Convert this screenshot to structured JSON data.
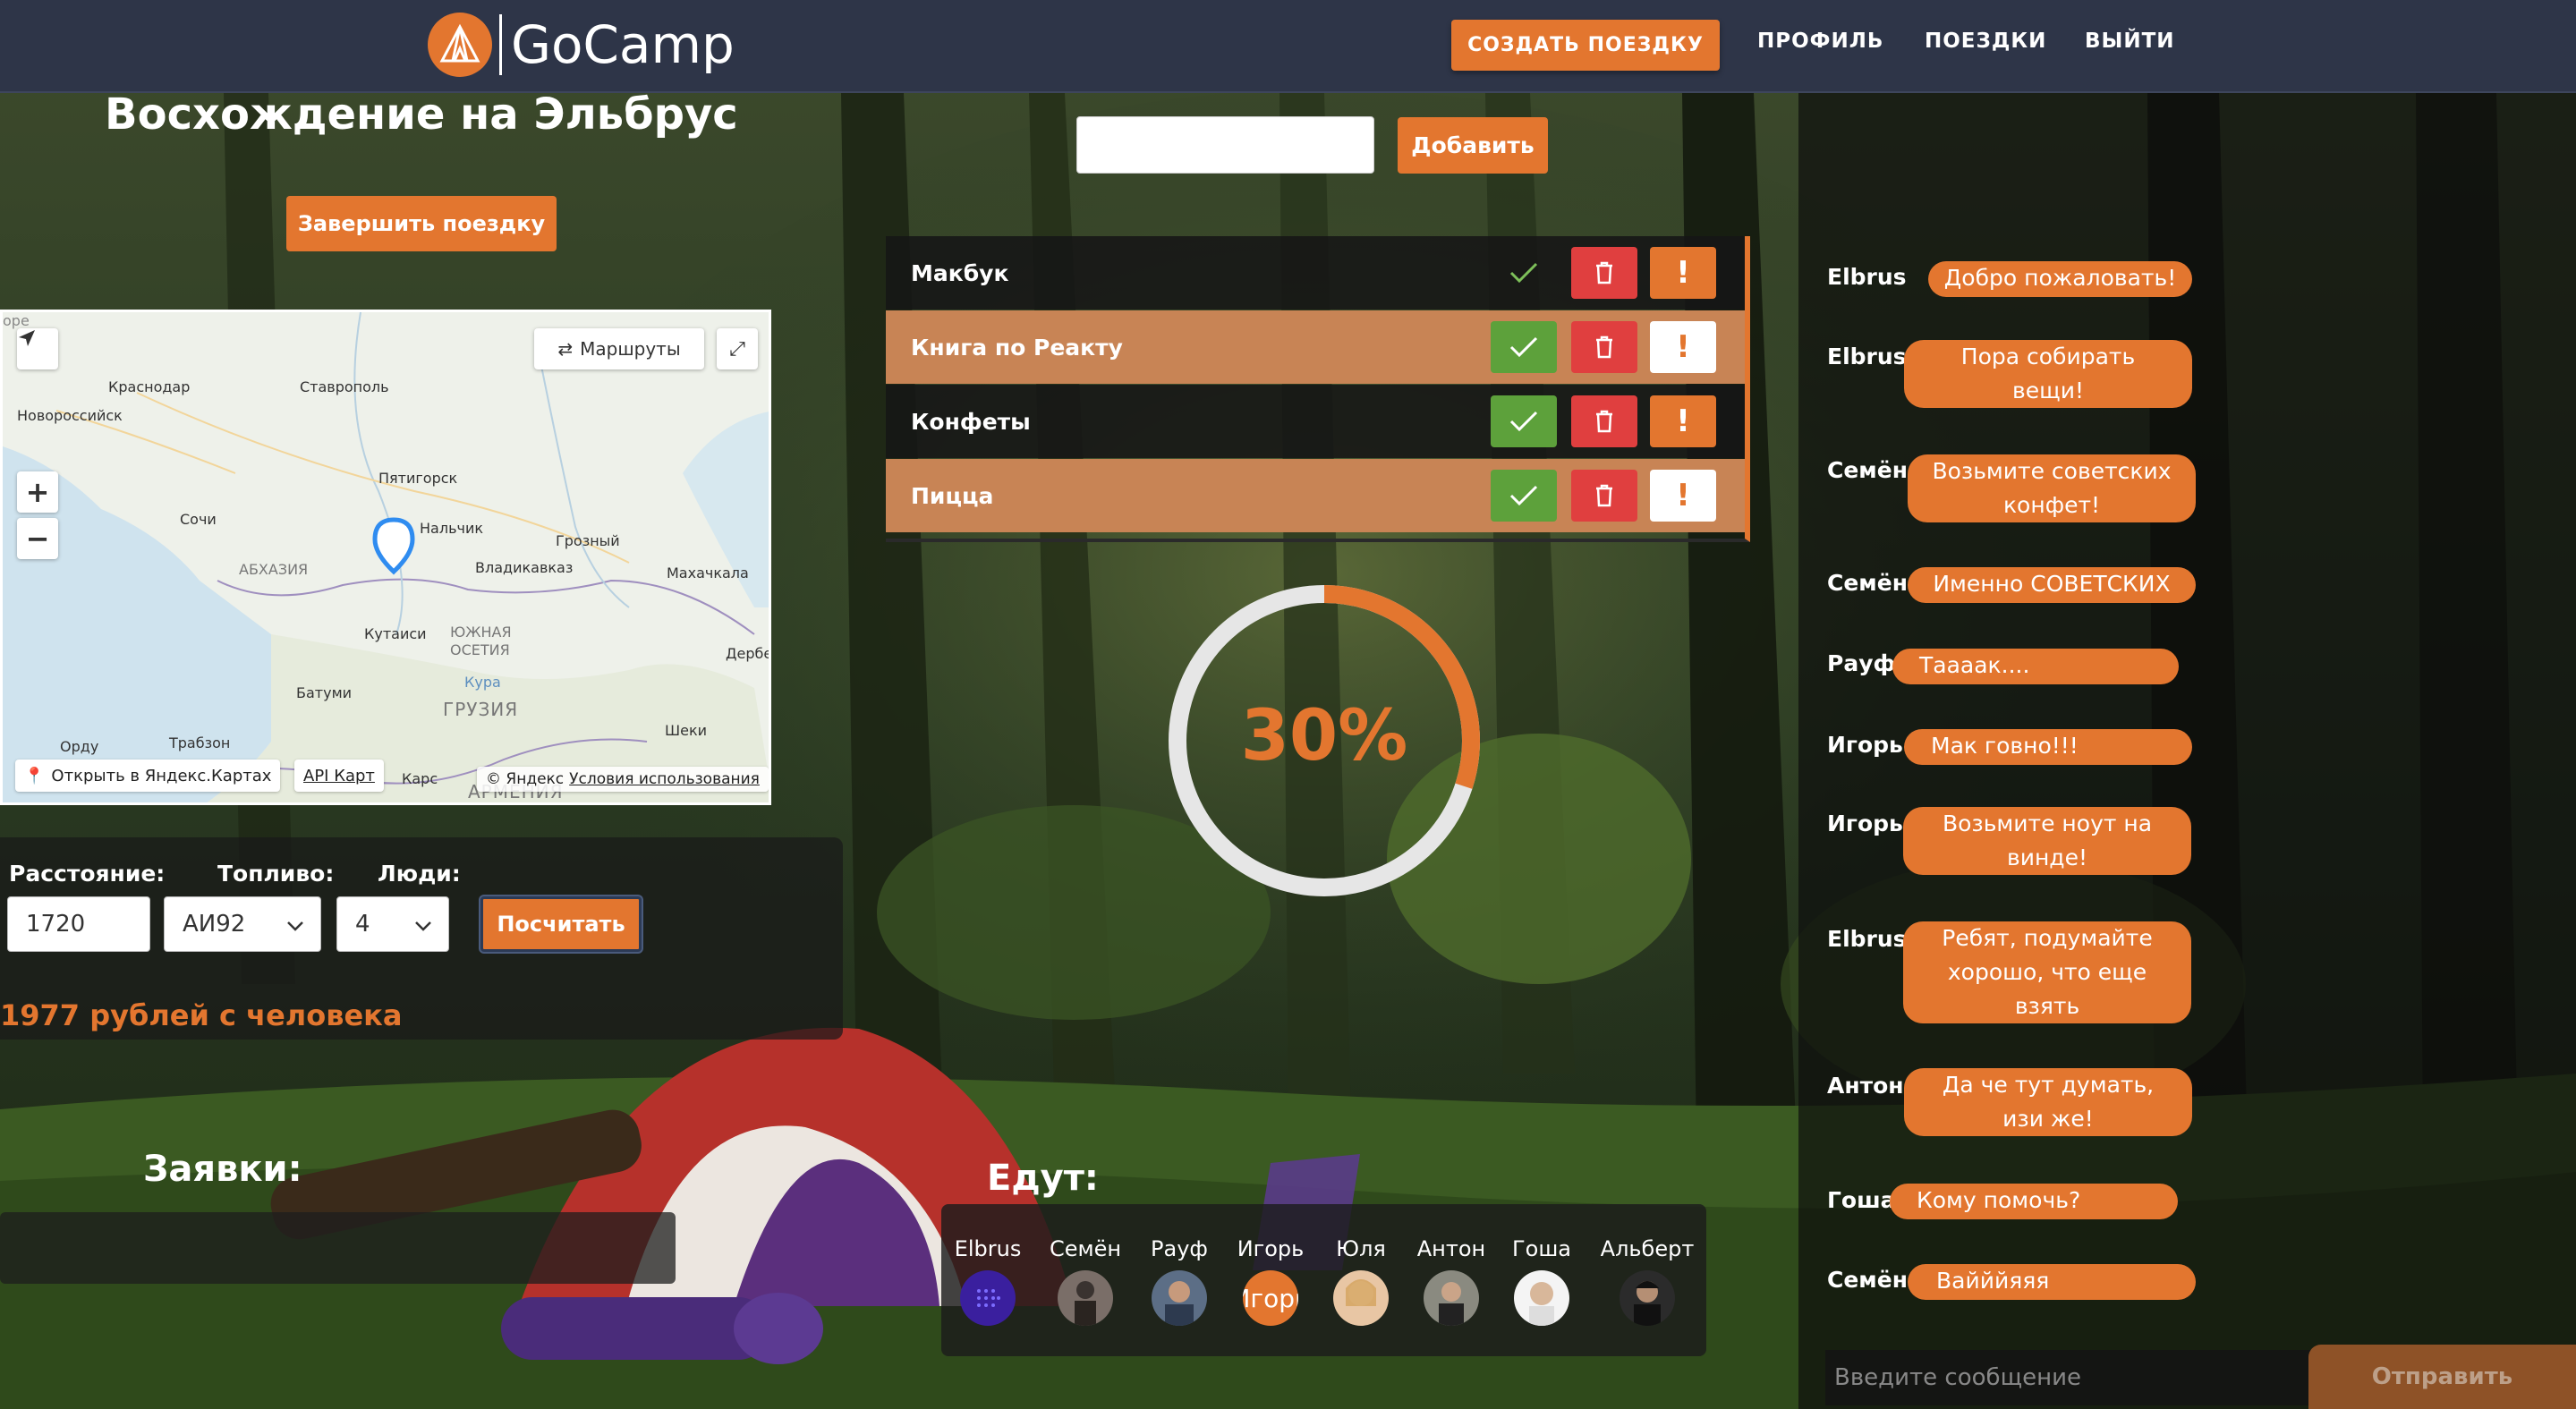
{
  "header": {
    "logo_text": "GoCamp",
    "create_trip": "СОЗДАТЬ ПОЕЗДКУ",
    "profile": "ПРОФИЛЬ",
    "trips": "ПОЕЗДКИ",
    "logout": "ВЫЙТИ"
  },
  "trip": {
    "title": "Восхождение на Эльбрус",
    "finish_button": "Завершить поездку"
  },
  "map": {
    "routes_button": "Маршруты",
    "open_in_yandex": "Открыть в Яндекс.Картах",
    "api_link": "API Карт",
    "copyright": "© Яндекс",
    "terms": "Условия использования",
    "labels": {
      "krasnodar": "Краснодар",
      "stavropol": "Ставрополь",
      "novorossiysk": "Новороссийск",
      "pyatigorsk": "Пятигорск",
      "sochi": "Сочи",
      "nalchik": "Нальчик",
      "grozny": "Грозный",
      "abkhazia": "АБХАЗИЯ",
      "vladikavkaz": "Владикавказ",
      "makhachkala": "Махачкала",
      "kutaisi": "Кутаиси",
      "south_ossetia_1": "ЮЖНАЯ",
      "south_ossetia_2": "ОСЕТИЯ",
      "derbent": "Дербе",
      "batumi": "Батуми",
      "kura": "Кура",
      "georgia": "ГРУЗИЯ",
      "sheki": "Шеки",
      "ordu": "Орду",
      "trabzon": "Трабзон",
      "kars": "Карс",
      "armenia": "АРМЕНИЯ",
      "europe": "ope"
    }
  },
  "calculator": {
    "distance_label": "Расстояние:",
    "fuel_label": "Топливо:",
    "people_label": "Люди:",
    "distance_value": "1720",
    "fuel_value": "АИ92",
    "people_value": "4",
    "button": "Посчитать",
    "result": "1977 рублей с человека"
  },
  "requests": {
    "title": "Заявки:"
  },
  "items": {
    "add_button": "Добавить",
    "list": [
      {
        "name": "Макбук",
        "checked": false
      },
      {
        "name": "Книга по Реакту",
        "checked": true
      },
      {
        "name": "Конфеты",
        "checked": true
      },
      {
        "name": "Пицца",
        "checked": true
      }
    ],
    "warn_symbol": "!"
  },
  "progress": {
    "percent": 30,
    "label": "30%"
  },
  "going": {
    "title": "Едут:",
    "members": [
      {
        "name": "Elbrus",
        "avatar": "purple-dots-avatar"
      },
      {
        "name": "Семён",
        "avatar": "photo-avatar"
      },
      {
        "name": "Рауф",
        "avatar": "photo-avatar"
      },
      {
        "name": "Игорь",
        "avatar": "orange-text-avatar",
        "avatar_text": "Игорь"
      },
      {
        "name": "Юля",
        "avatar": "photo-avatar"
      },
      {
        "name": "Антон",
        "avatar": "photo-avatar"
      },
      {
        "name": "Гоша",
        "avatar": "photo-avatar"
      },
      {
        "name": "Альберт",
        "avatar": "photo-avatar"
      }
    ]
  },
  "chat": {
    "messages": [
      {
        "sender": "Elbrus",
        "text": "Добро пожаловать!"
      },
      {
        "sender": "Elbrus",
        "text_lines": [
          "Пора собирать",
          "вещи!"
        ]
      },
      {
        "sender": "Семён",
        "text_lines": [
          "Возьмите советских",
          "конфет!"
        ]
      },
      {
        "sender": "Семён",
        "text": "Именно СОВЕТСКИХ"
      },
      {
        "sender": "Рауф",
        "text": "Таааак...."
      },
      {
        "sender": "Игорь",
        "text": "Мак говно!!!"
      },
      {
        "sender": "Игорь",
        "text_lines": [
          "Возьмите ноут на",
          "винде!"
        ]
      },
      {
        "sender": "Elbrus",
        "text_lines": [
          "Ребят, подумайте",
          "хорошо, что еще",
          "взять"
        ]
      },
      {
        "sender": "Антон",
        "text_lines": [
          "Да че тут думать,",
          "изи же!"
        ]
      },
      {
        "sender": "Гоша",
        "text": "Кому помочь?"
      },
      {
        "sender": "Семён",
        "text": "Вайййяяя"
      }
    ],
    "input_placeholder": "Введите сообщение",
    "send_button": "Отправить"
  },
  "colors": {
    "accent": "#e3762f",
    "header_bg": "#2e3548",
    "check_green": "#5da13b",
    "delete_red": "#e03f3f",
    "item_tan": "#c88455"
  }
}
